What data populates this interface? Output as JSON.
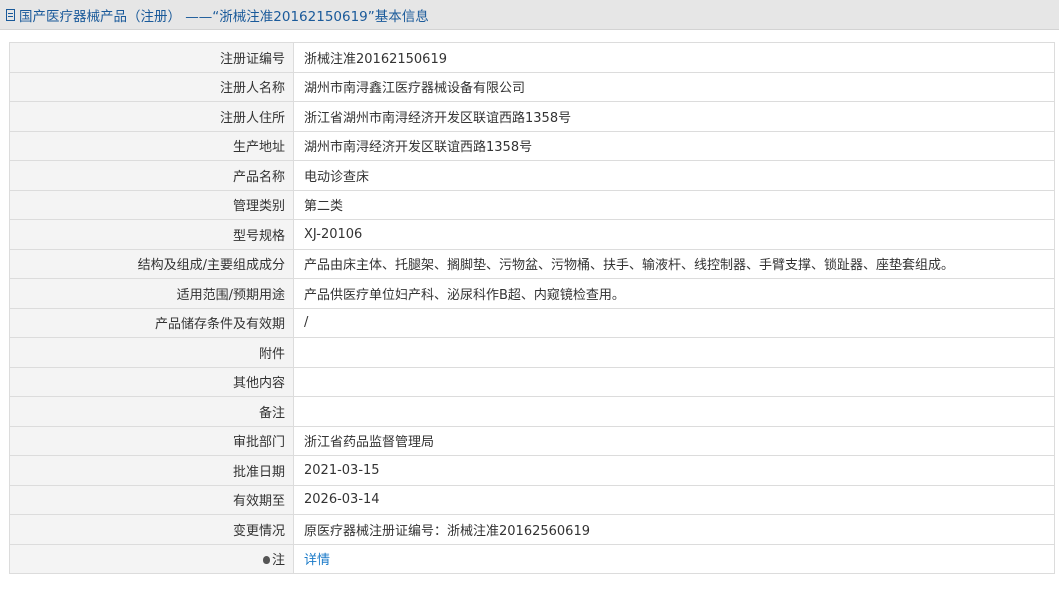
{
  "header": {
    "title": "国产医疗器械产品（注册） ——“浙械注准20162150619”基本信息"
  },
  "rows": [
    {
      "label": "注册证编号",
      "value": "浙械注准20162150619"
    },
    {
      "label": "注册人名称",
      "value": "湖州市南浔鑫江医疗器械设备有限公司"
    },
    {
      "label": "注册人住所",
      "value": "浙江省湖州市南浔经济开发区联谊西路1358号"
    },
    {
      "label": "生产地址",
      "value": "湖州市南浔经济开发区联谊西路1358号"
    },
    {
      "label": "产品名称",
      "value": "电动诊查床"
    },
    {
      "label": "管理类别",
      "value": "第二类"
    },
    {
      "label": "型号规格",
      "value": "XJ-20106"
    },
    {
      "label": "结构及组成/主要组成成分",
      "value": "产品由床主体、托腿架、搁脚垫、污物盆、污物桶、扶手、输液杆、线控制器、手臂支撑、锁趾器、座垫套组成。"
    },
    {
      "label": "适用范围/预期用途",
      "value": "产品供医疗单位妇产科、泌尿科作B超、内窥镜检查用。"
    },
    {
      "label": "产品储存条件及有效期",
      "value": "/"
    },
    {
      "label": "附件",
      "value": ""
    },
    {
      "label": "其他内容",
      "value": ""
    },
    {
      "label": "备注",
      "value": ""
    },
    {
      "label": "审批部门",
      "value": "浙江省药品监督管理局"
    },
    {
      "label": "批准日期",
      "value": "2021-03-15"
    },
    {
      "label": "有效期至",
      "value": "2026-03-14"
    },
    {
      "label": "变更情况",
      "value": "原医疗器械注册证编号：浙械注准20162560619"
    }
  ],
  "note": {
    "label": "注",
    "link_text": "详情",
    "icon": "bulb-icon"
  }
}
